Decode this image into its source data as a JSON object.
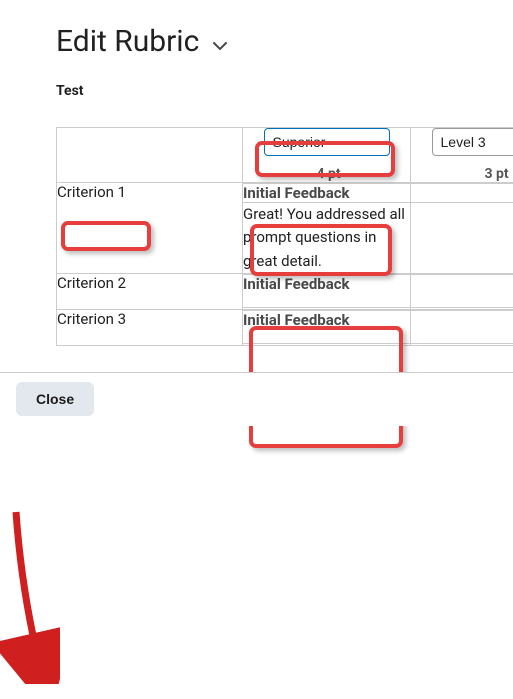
{
  "title": "Edit Rubric",
  "rubric_name": "Test",
  "levels": [
    {
      "name": "Superior",
      "points": "4 pt"
    },
    {
      "name": "Level 3",
      "points": "3 pt"
    }
  ],
  "criteria": [
    {
      "name": "Criterion 1",
      "feedback_label": "Initial Feedback",
      "feedback_text": "Great! You addressed all prompt questions in great detail.",
      "cells": [
        "",
        ""
      ]
    },
    {
      "name": "Criterion 2",
      "feedback_label": "Initial Feedback",
      "feedback_text": "",
      "cells": [
        "",
        ""
      ]
    },
    {
      "name": "Criterion 3",
      "feedback_label": "Initial Feedback",
      "feedback_text": "",
      "cells": [
        "",
        ""
      ]
    }
  ],
  "footer": {
    "close": "Close"
  }
}
